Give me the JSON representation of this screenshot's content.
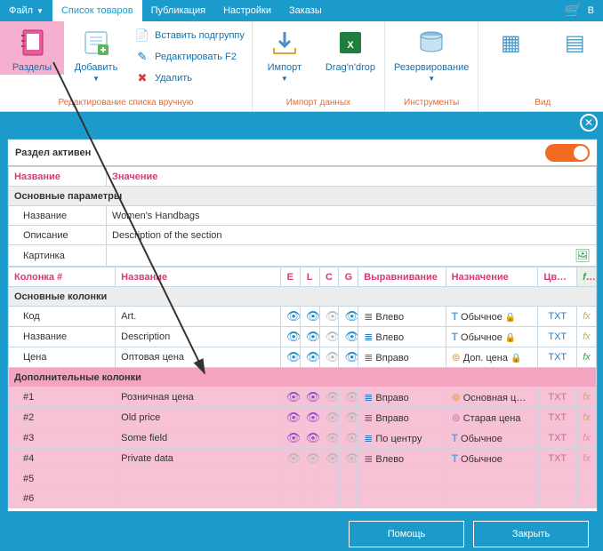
{
  "menu": {
    "file": "Файл",
    "list": "Список товаров",
    "publish": "Публикация",
    "settings": "Настройки",
    "orders": "Заказы",
    "cart": "В"
  },
  "ribbon": {
    "sections": "Разделы",
    "add": "Добавить",
    "insert_sub": "Вставить подгруппу",
    "edit_f2": "Редактировать F2",
    "delete": "Удалить",
    "grp_edit": "Редактирование списка вручную",
    "import": "Импорт",
    "dragdrop": "Drag'n'drop",
    "grp_import": "Импорт данных",
    "backup": "Резервирование",
    "grp_tools": "Инструменты",
    "grp_view": "Вид"
  },
  "dialog": {
    "active_label": "Раздел активен",
    "hdr_name": "Название",
    "hdr_value": "Значение",
    "grp_main": "Основные параметры",
    "row_name": "Название",
    "val_name": "Women's Handbags",
    "row_desc": "Описание",
    "val_desc": "Description of the section",
    "row_pic": "Картинка",
    "hdr_col": "Колонка #",
    "hdr_colname": "Название",
    "hdr_E": "E",
    "hdr_L": "L",
    "hdr_C": "C",
    "hdr_G": "G",
    "hdr_align": "Выравнивание",
    "hdr_purpose": "Назначение",
    "hdr_colors": "Цвета",
    "fx": "fx",
    "grp_maincols": "Основные колонки",
    "cols": [
      {
        "key": "Код",
        "name": "Art.",
        "e": "blue",
        "l": "lock",
        "c": "gray",
        "g": "blue",
        "align": "Влево",
        "picon": "T",
        "purpose": "Обычное",
        "plock": true,
        "color": "TXT",
        "fx": "dim"
      },
      {
        "key": "Название",
        "name": "Description",
        "e": "blue",
        "l": "lock",
        "c": "gray",
        "g": "blue",
        "align": "Влево",
        "picon": "T",
        "purpose": "Обычное",
        "plock": true,
        "color": "TXT",
        "fx": "dim"
      },
      {
        "key": "Цена",
        "name": "Оптовая цена",
        "e": "blue",
        "l": "blue",
        "c": "gray",
        "g": "blue",
        "align": "Вправо",
        "picon": "coin",
        "purpose": "Доп. цена",
        "plock": true,
        "color": "TXT",
        "fx": "fx"
      }
    ],
    "grp_addcols": "Дополнительные колонки",
    "addcols": [
      {
        "key": "#1",
        "name": "Розничная цена",
        "e": "purple",
        "l": "purple",
        "c": "gray",
        "g": "gray",
        "align": "Вправо",
        "picon": "coin",
        "purpose": "Основная ц…",
        "color": "TXT",
        "fx": "dim"
      },
      {
        "key": "#2",
        "name": "Old price",
        "e": "purple",
        "l": "purple",
        "c": "gray",
        "g": "gray",
        "align": "Вправо",
        "picon": "coinpink",
        "purpose": "Старая цена",
        "color": "TXT",
        "fx": "dim"
      },
      {
        "key": "#3",
        "name": "Some field",
        "e": "purple",
        "l": "purple",
        "c": "gray",
        "g": "gray",
        "align": "По центру",
        "picon": "T",
        "purpose": "Обычное",
        "color": "TXT",
        "fx": "pink"
      },
      {
        "key": "#4",
        "name": "Private data",
        "e": "gray",
        "l": "gray",
        "c": "gray",
        "g": "gray",
        "align": "Влево",
        "picon": "T",
        "purpose": "Обычное",
        "color": "TXT",
        "fx": "pink"
      },
      {
        "key": "#5",
        "name": "",
        "e": "",
        "l": "",
        "c": "",
        "g": "",
        "align": "",
        "picon": "",
        "purpose": "",
        "color": "",
        "fx": ""
      },
      {
        "key": "#6",
        "name": "",
        "e": "",
        "l": "",
        "c": "",
        "g": "",
        "align": "",
        "picon": "",
        "purpose": "",
        "color": "",
        "fx": ""
      }
    ],
    "help": "Помощь",
    "close": "Закрыть"
  }
}
